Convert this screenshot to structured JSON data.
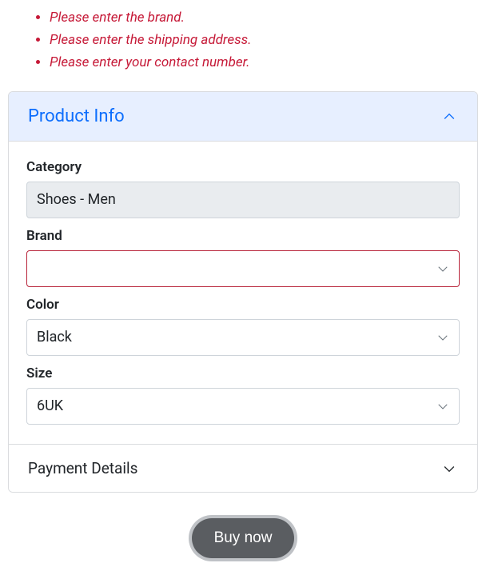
{
  "errors": [
    "Please enter the brand.",
    "Please enter the shipping address.",
    "Please enter your contact number."
  ],
  "accordion": {
    "product": {
      "title": "Product Info",
      "fields": {
        "category": {
          "label": "Category",
          "value": "Shoes - Men"
        },
        "brand": {
          "label": "Brand",
          "value": ""
        },
        "color": {
          "label": "Color",
          "value": "Black"
        },
        "size": {
          "label": "Size",
          "value": "6UK"
        }
      }
    },
    "payment": {
      "title": "Payment Details"
    }
  },
  "actions": {
    "buy": "Buy now"
  }
}
